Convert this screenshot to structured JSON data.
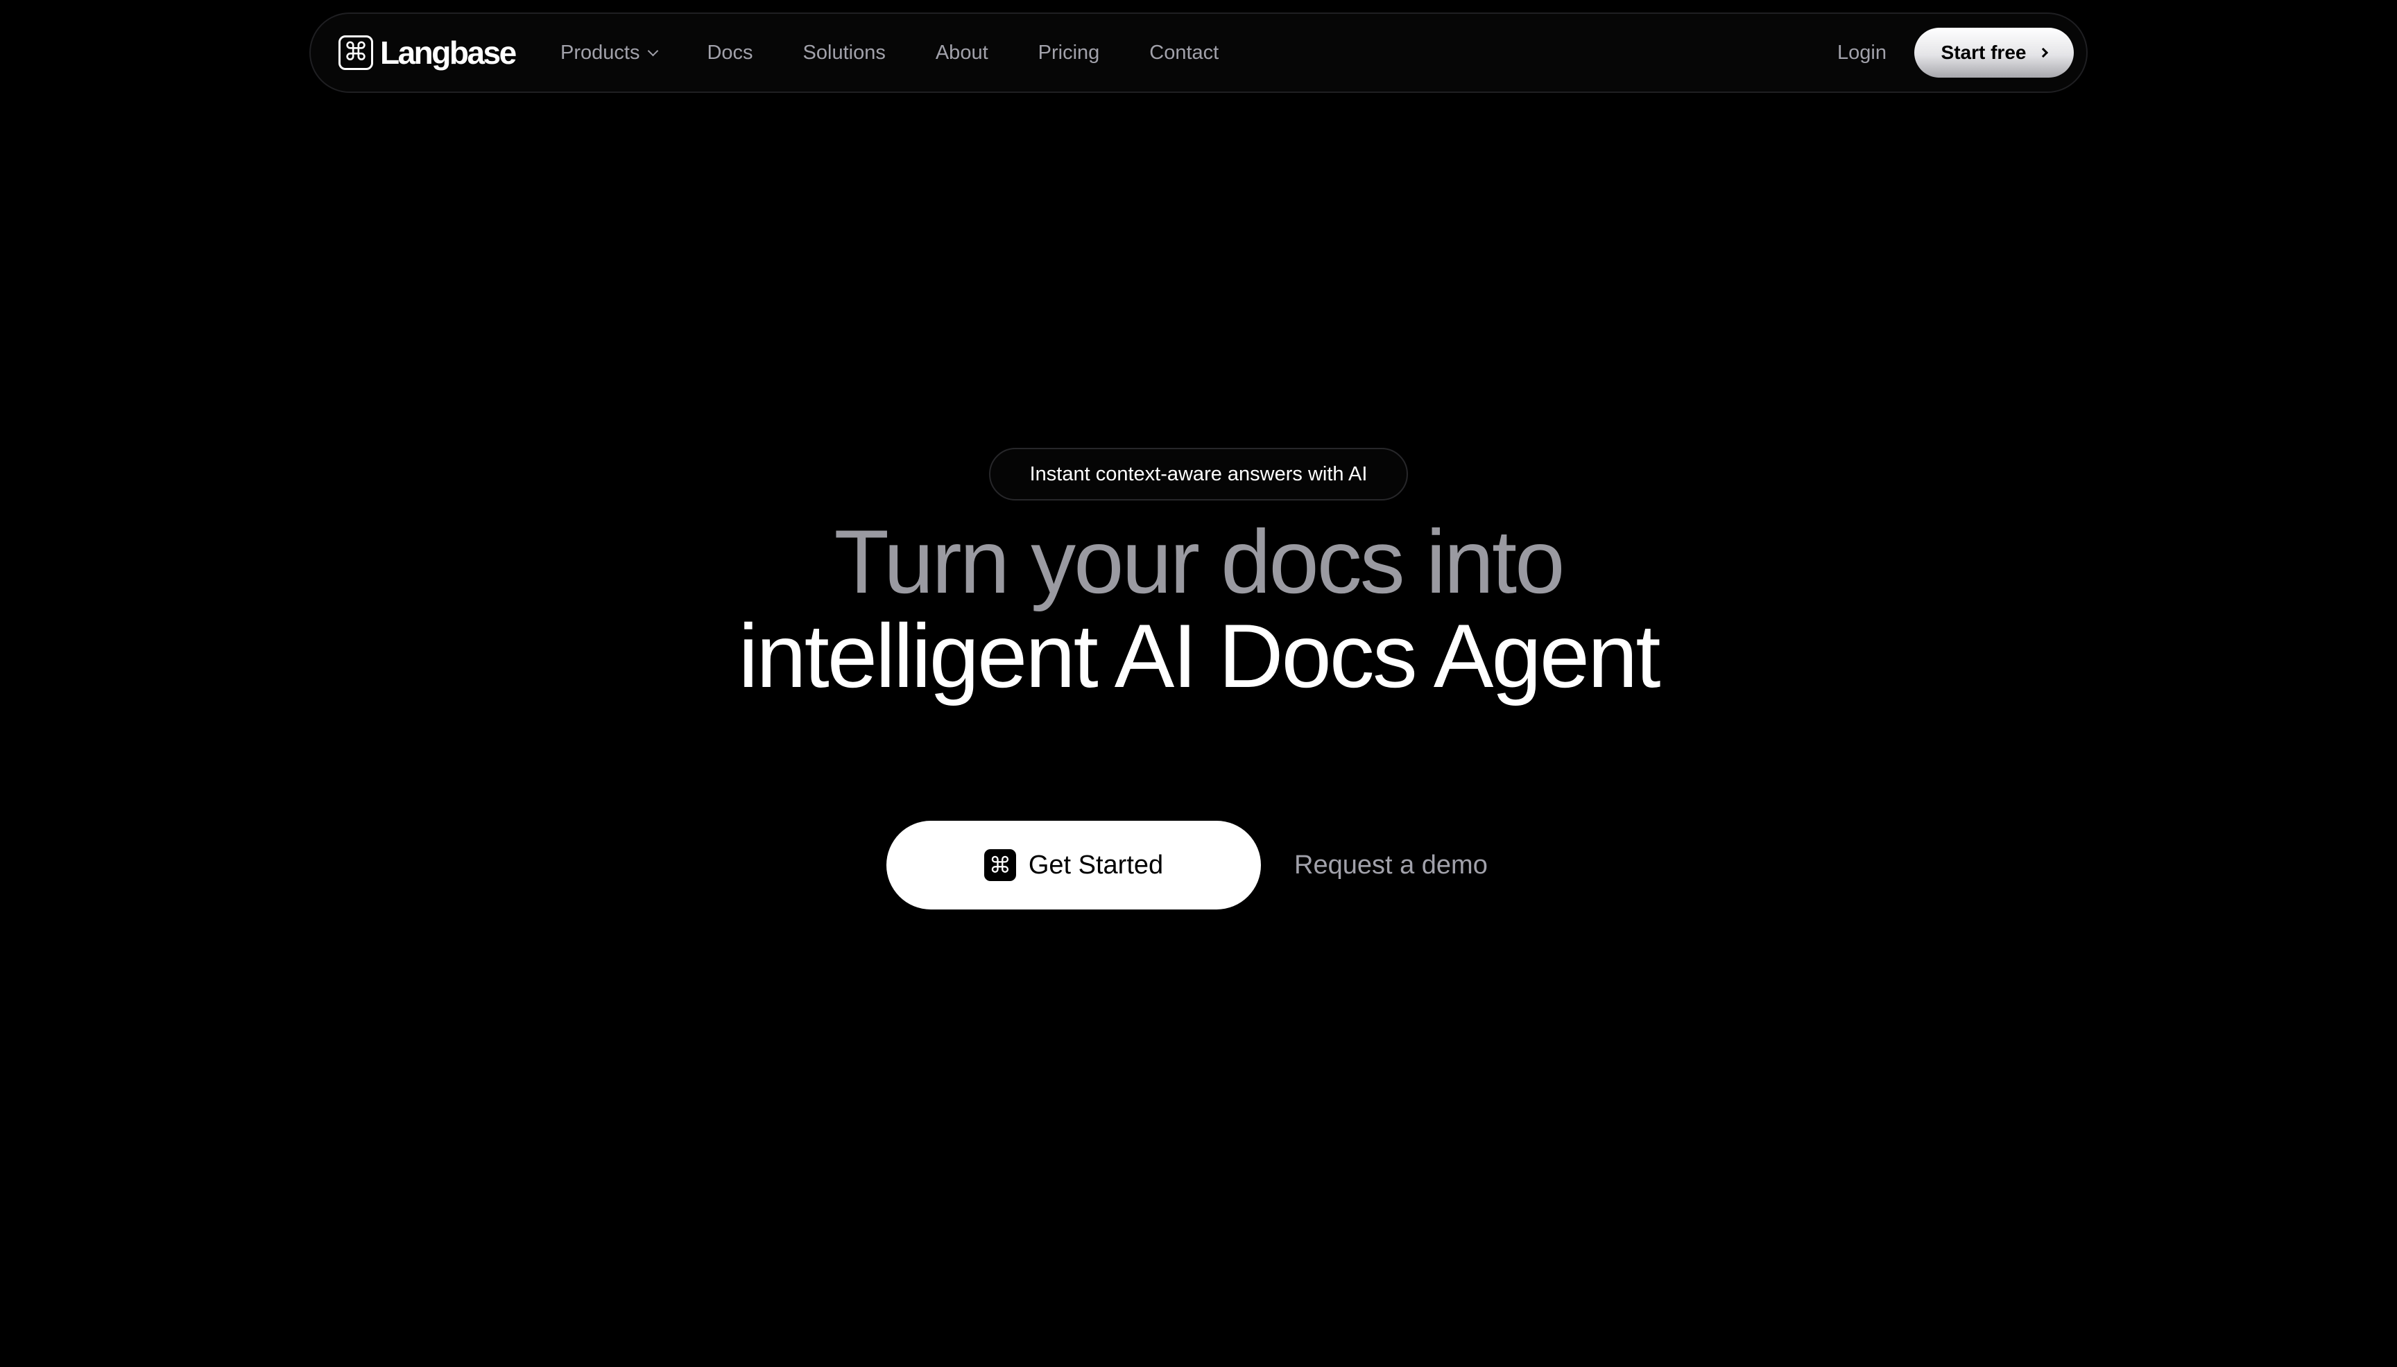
{
  "nav": {
    "logo_symbol": "⌘",
    "logo_text": "Langbase",
    "links": [
      {
        "label": "Products"
      },
      {
        "label": "Docs"
      },
      {
        "label": "Solutions"
      },
      {
        "label": "About"
      },
      {
        "label": "Pricing"
      },
      {
        "label": "Contact"
      }
    ],
    "login_label": "Login",
    "start_free_label": "Start free"
  },
  "hero": {
    "badge": "Instant context-aware answers with AI",
    "headline_line1": "Turn your docs into",
    "headline_line2": "intelligent AI Docs Agent",
    "primary_cta_icon": "⌘",
    "primary_cta_label": "Get Started",
    "secondary_cta_label": "Request a demo"
  },
  "icons": {
    "logo": "command-icon",
    "products_dropdown": "chevron-down-icon",
    "start_free_arrow": "chevron-right-icon",
    "get_started": "command-icon"
  },
  "colors": {
    "background": "#000000",
    "text_primary": "#ffffff",
    "text_muted": "#a1a1aa",
    "headline_muted": "#9a9aa1",
    "button_bg": "#ffffff"
  }
}
